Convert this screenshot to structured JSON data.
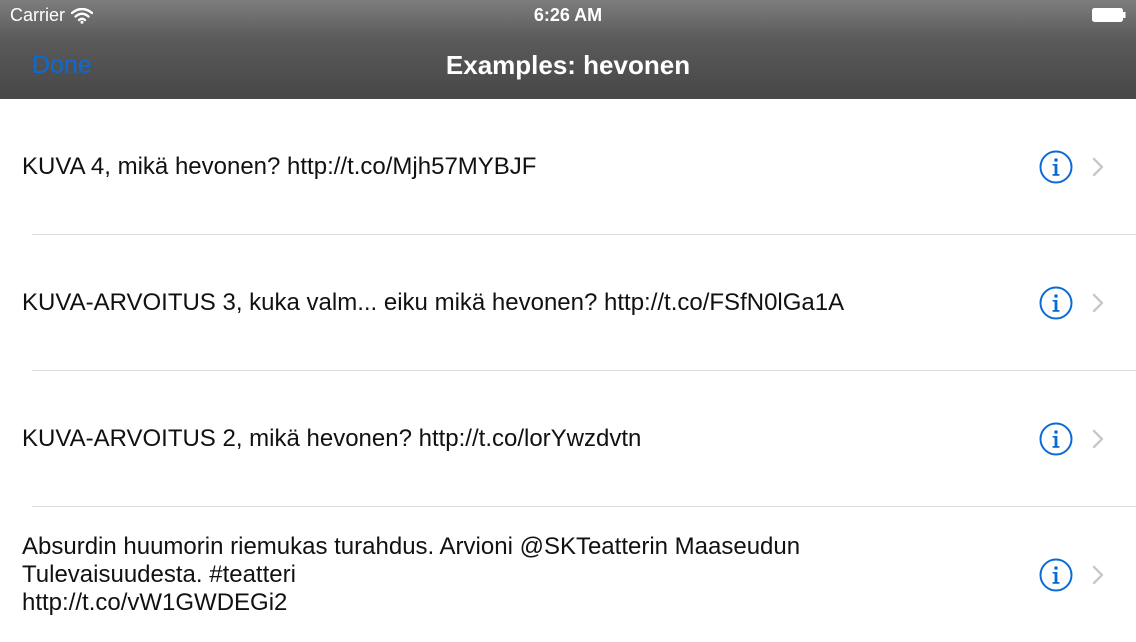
{
  "status_bar": {
    "carrier": "Carrier",
    "time": "6:26 AM",
    "icons": [
      "wifi-icon",
      "battery-icon"
    ]
  },
  "nav_bar": {
    "done_label": "Done",
    "title": "Examples: hevonen"
  },
  "colors": {
    "accent": "#0a6ad6",
    "header_top": "#7d7d7d",
    "header_bottom": "#474747",
    "separator": "#dcdcdc"
  },
  "rows": [
    {
      "line1": "KUVA 4, mikä hevonen? http://t.co/Mjh57MYBJF",
      "line2": "",
      "line3": ""
    },
    {
      "line1": "KUVA-ARVOITUS 3, kuka valm... eiku mikä hevonen? http://t.co/FSfN0lGa1A",
      "line2": "",
      "line3": ""
    },
    {
      "line1": "KUVA-ARVOITUS 2, mikä hevonen? http://t.co/lorYwzdvtn",
      "line2": "",
      "line3": ""
    },
    {
      "line1": "Absurdin huumorin riemukas turahdus. Arvioni @SKTeatterin Maaseudun",
      "line2": "Tulevaisuudesta. #teatteri",
      "line3": "http://t.co/vW1GWDEGi2"
    }
  ]
}
